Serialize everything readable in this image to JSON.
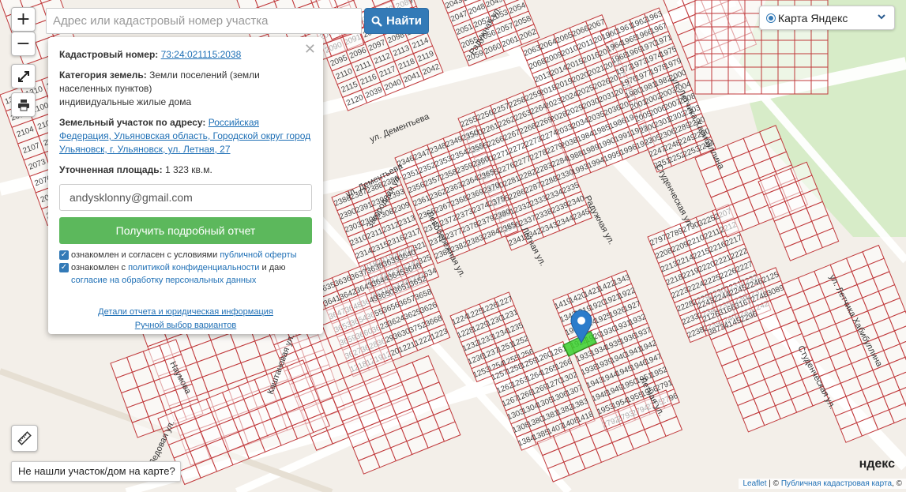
{
  "search": {
    "placeholder": "Адрес или кадастровый номер участка",
    "button_label": "Найти"
  },
  "controls": {
    "zoom_in": "+",
    "zoom_out": "−"
  },
  "layer_select": {
    "selected": "Карта Яндекс"
  },
  "popup": {
    "cadastral_label": "Кадастровый номер:",
    "cadastral_value": "73:24:021115:2038",
    "category_label": "Категория земель:",
    "category_value": "Земли поселений (земли населенных пунктов)",
    "usage_value": "индивидуальные жилые дома",
    "address_label": "Земельный участок по адресу:",
    "address_value": "Российская Федерация, Ульяновская область, Городской округ город Ульяновск, г. Ульяновск, ул. Летная, 27",
    "area_label": "Уточненная площадь:",
    "area_value": "1 323 кв.м.",
    "email_value": "andysklonny@gmail.com",
    "report_button": "Получить подробный отчет",
    "agree1_prefix": "ознакомлен и согласен с условиями",
    "agree1_link": "публичной оферты",
    "agree2_prefix": "ознакомлен с",
    "agree2_link": "политикой конфиденциальности",
    "agree2_mid": "и даю",
    "agree2_link2": "согласие на обработку персональных данных",
    "details_link": "Детали отчета и юридическая информация",
    "manual_link": "Ручной выбор вариантов"
  },
  "not_found_label": "Не нашли участок/дом на карте?",
  "attribution": {
    "leaflet": "Leaflet",
    "sep": "| ©",
    "source": "Публичная кадастровая карта",
    "suffix": ", ©"
  },
  "yandex_logo": "ндекс",
  "map": {
    "streets": [
      "ул. Дементьева",
      "ул. Дементьева",
      "Радужная ул.",
      "Радужная ул.",
      "Летная ул.",
      "Летная ул.",
      "Левобережная ул.",
      "Загородная ул.",
      "Студенческая ул.",
      "Студенческая ул.",
      "ул. Летчика Хабибуллина",
      "ул. Летчика Хабибуллина",
      "Каштановая ул.",
      "Наумова",
      "Ледовая ул."
    ],
    "parcel_labels": [
      "1309",
      "1310",
      "1352",
      "2099",
      "2100",
      "2103",
      "2104",
      "2105",
      "2106",
      "2107",
      "2069",
      "2070",
      "2073",
      "2074",
      "2075",
      "2076",
      "2077",
      "2078",
      "2079",
      "2080",
      "2081",
      "2082",
      "2083",
      "2084",
      "2085",
      "2086",
      "2087",
      "2088",
      "2089",
      "2090",
      "2091",
      "2092",
      "2093",
      "2094",
      "2095",
      "2096",
      "2097",
      "2098",
      "2109",
      "2110",
      "2111",
      "2112",
      "2113",
      "2114",
      "2115",
      "2116",
      "2117",
      "2118",
      "2119",
      "2120",
      "2039",
      "2040",
      "2041",
      "2042",
      "2043",
      "2044",
      "2045",
      "2046",
      "2047",
      "2048",
      "2049",
      "2050",
      "2051",
      "2052",
      "2053",
      "2054",
      "2055",
      "2056",
      "2057",
      "2058",
      "2059",
      "2060",
      "2061",
      "2062",
      "2063",
      "2064",
      "2065",
      "2066",
      "2067",
      "2068",
      "2009",
      "2010",
      "2011",
      "2012",
      "2013",
      "2014",
      "2015",
      "2016",
      "2017",
      "2018",
      "2019",
      "2020",
      "2021",
      "2022",
      "2023",
      "2024",
      "2025",
      "2026",
      "2027",
      "2028",
      "2029",
      "2030",
      "2031",
      "2032",
      "2033",
      "2034",
      "2035",
      "2036",
      "2037",
      "2038",
      "1984",
      "1985",
      "1986",
      "1987",
      "1988",
      "1989",
      "1990",
      "1991",
      "1992",
      "1993",
      "1994",
      "1995",
      "1996",
      "1997",
      "1960",
      "1961",
      "1962",
      "1963",
      "1964",
      "1965",
      "1966",
      "1967",
      "1968",
      "1969",
      "1970",
      "1971",
      "1972",
      "1973",
      "1974",
      "1975",
      "1976",
      "1977",
      "1978",
      "1979",
      "1980",
      "1981",
      "1982",
      "2000",
      "2001",
      "2002",
      "2003",
      "2004",
      "2005",
      "2006",
      "2007",
      "2008",
      "2300",
      "2301",
      "2302",
      "2303",
      "2305",
      "2306",
      "2289",
      "2290",
      "2247",
      "2248",
      "2249",
      "2250",
      "2251",
      "2252",
      "2253",
      "2254",
      "2255",
      "2256",
      "2257",
      "2258",
      "2259",
      "2260",
      "2261",
      "2262",
      "2263",
      "2264",
      "2265",
      "2266",
      "2267",
      "2268",
      "2269",
      "2270",
      "2271",
      "2272",
      "2273",
      "2274",
      "2275",
      "2276",
      "2277",
      "2278",
      "2279",
      "2280",
      "2281",
      "2282",
      "2283",
      "2284",
      "2285",
      "2286",
      "2287",
      "2288",
      "2330",
      "2331",
      "2332",
      "2333",
      "2334",
      "2335",
      "2336",
      "2337",
      "2338",
      "2339",
      "2340",
      "2341",
      "2342",
      "2343",
      "2344",
      "2345",
      "2346",
      "2347",
      "2348",
      "2349",
      "2350",
      "2351",
      "2352",
      "2353",
      "2354",
      "2355",
      "2356",
      "2357",
      "2358",
      "2359",
      "2360",
      "2361",
      "2362",
      "2363",
      "2364",
      "2365",
      "2366",
      "2367",
      "2368",
      "2369",
      "2370",
      "2371",
      "2372",
      "2373",
      "2374",
      "2375",
      "2376",
      "2377",
      "2378",
      "2379",
      "2380",
      "2381",
      "2382",
      "2383",
      "2384",
      "2385",
      "2386",
      "2387",
      "2388",
      "2389",
      "2390",
      "2391",
      "2392",
      "2393",
      "2303",
      "2304",
      "2308",
      "2309",
      "2310",
      "2311",
      "2312",
      "2313",
      "2314",
      "2315",
      "2316",
      "2317",
      "2318",
      "2319",
      "2320",
      "2321",
      "2322",
      "2323",
      "2324",
      "2325",
      "3631",
      "3632",
      "3633",
      "3634",
      "3635",
      "3636",
      "3637",
      "3638",
      "3639",
      "3640",
      "3641",
      "3642",
      "3643",
      "3644",
      "3645",
      "3646",
      "3647",
      "3648",
      "3649",
      "3650",
      "3651",
      "3652",
      "3653",
      "3654",
      "3655",
      "3656",
      "3657",
      "3658",
      "3659",
      "3660",
      "3623",
      "3624",
      "3625",
      "3626",
      "3627",
      "3628",
      "3629",
      "3630",
      "3752",
      "3668",
      "1218",
      "1219",
      "1220",
      "1221",
      "1222",
      "1223",
      "1224",
      "1225",
      "1226",
      "1227",
      "1228",
      "1229",
      "1230",
      "1231",
      "1232",
      "1233",
      "1234",
      "1235",
      "1236",
      "1237",
      "1251",
      "1252",
      "1253",
      "1254",
      "1255",
      "1256",
      "1257",
      "1258",
      "1259",
      "1260",
      "1261",
      "1262",
      "1263",
      "1264",
      "1265",
      "1266",
      "1267",
      "1268",
      "1269",
      "1270",
      "1302",
      "1303",
      "1304",
      "1305",
      "1306",
      "1307",
      "1308",
      "1380",
      "1381",
      "1382",
      "1383",
      "1384",
      "1385",
      "1407",
      "1408",
      "1418",
      "1419",
      "1420",
      "1421",
      "1422",
      "1343",
      "1342",
      "1919",
      "1920",
      "1921",
      "1922",
      "1923",
      "1924",
      "1925",
      "1926",
      "1927",
      "1928",
      "1929",
      "1930",
      "1931",
      "1932",
      "1933",
      "1934",
      "1935",
      "1936",
      "1937",
      "1938",
      "1939",
      "1940",
      "1941",
      "1942",
      "1943",
      "1944",
      "1945",
      "1946",
      "1947",
      "1948",
      "1949",
      "1950",
      "1951",
      "1952",
      "1953",
      "1954",
      "1955",
      "1956",
      "2791",
      "2792",
      "2793",
      "2794",
      "2795",
      "2796",
      "2797",
      "2789",
      "2790",
      "3225",
      "2207",
      "2208",
      "2209",
      "2210",
      "2211",
      "2212",
      "2213",
      "2214",
      "2215",
      "2216",
      "2217",
      "2218",
      "2219",
      "2220",
      "2221",
      "2222",
      "2223",
      "2224",
      "2225",
      "2226",
      "2227",
      "2228",
      "2229",
      "2230",
      "2231",
      "2232",
      "2233",
      "2234",
      "2235",
      "2236",
      "2237",
      "2238",
      "2239",
      "2240",
      "2241",
      "2242",
      "2243",
      "2244",
      "2245",
      "2246",
      "2125",
      "2126",
      "3166",
      "3167",
      "2748",
      "3089",
      "3873",
      "4145",
      "2296"
    ]
  }
}
